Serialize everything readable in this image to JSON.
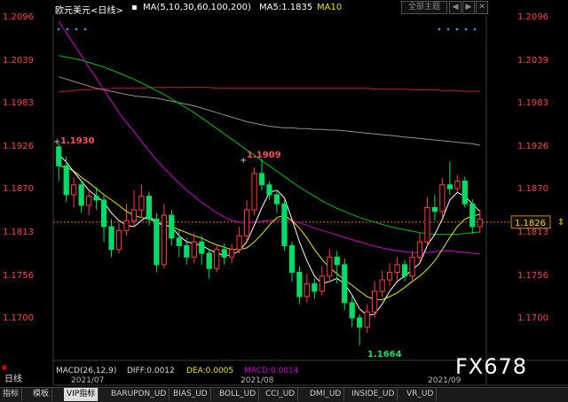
{
  "header": {
    "symbol": "欧元美元<日线>",
    "ma_label": "MA(5,10,30,60,100,200)",
    "ma5_label": "MA5:1.1835",
    "ma10_label": "MA10",
    "theme_button": "全部主题",
    "arrow_left": "◀",
    "arrow_right": "▶",
    "close": "✕"
  },
  "y_axis": {
    "ticks": [
      "1.2096",
      "1.2039",
      "1.1983",
      "1.1926",
      "1.1870",
      "1.1813",
      "1.1756",
      "1.1700"
    ],
    "current_price": "1.1826",
    "current_marker": "⇕"
  },
  "annotations": {
    "left_high": "1.1930",
    "mid_high": "1.1909",
    "low": "1.1664"
  },
  "x_axis": {
    "labels": [
      "2021/07",
      "2021/08",
      "2021/09"
    ]
  },
  "indicator": {
    "day_label": "日线",
    "macd_label": "MACD(26,12,9)",
    "diff_label": "DIFF:0.0012",
    "dea_label": "DEA:0.0005",
    "macd_value": "MACD:0.0014"
  },
  "watermark": "FX678",
  "tabs": [
    "指标",
    "模板",
    "VIP指标",
    "BARUPDN_UD",
    "BIAS_UD",
    "BOLL_UD",
    "CCI_UD",
    "DMI_UD",
    "INSIDE_UD",
    "VR_UD"
  ],
  "colors": {
    "up": "#ff3c3c",
    "down": "#00e0e0",
    "axis_text": "#ff4040",
    "ma5": "#ffffff",
    "ma10": "#e8e800",
    "ma30": "#d000d0",
    "ma60": "#00c000",
    "ma100": "#909090",
    "ma200": "#c02020"
  },
  "chart_data": {
    "type": "candlestick",
    "title": "欧元美元<日线>",
    "x_labels": [
      "2021/07",
      "2021/08",
      "2021/09"
    ],
    "ylim": [
      1.1664,
      1.2096
    ],
    "y_ticks": [
      1.2096,
      1.2039,
      1.1983,
      1.1926,
      1.187,
      1.1813,
      1.1756,
      1.17
    ],
    "current_price": 1.1826,
    "candles": [
      [
        1.1925,
        1.19,
        1.193,
        1.188
      ],
      [
        1.19,
        1.1862,
        1.1912,
        1.1852
      ],
      [
        1.1862,
        1.1875,
        1.1885,
        1.1845
      ],
      [
        1.1875,
        1.1848,
        1.1882,
        1.1838
      ],
      [
        1.1848,
        1.186,
        1.1868,
        1.1835
      ],
      [
        1.186,
        1.1855,
        1.1872,
        1.1842
      ],
      [
        1.1855,
        1.182,
        1.1862,
        1.18
      ],
      [
        1.182,
        1.179,
        1.183,
        1.178
      ],
      [
        1.179,
        1.1815,
        1.1825,
        1.1785
      ],
      [
        1.1815,
        1.1828,
        1.185,
        1.1808
      ],
      [
        1.1828,
        1.1842,
        1.1868,
        1.182
      ],
      [
        1.1842,
        1.186,
        1.1875,
        1.1832
      ],
      [
        1.186,
        1.183,
        1.1866,
        1.1822
      ],
      [
        1.183,
        1.177,
        1.1838,
        1.176
      ],
      [
        1.177,
        1.1835,
        1.185,
        1.1765
      ],
      [
        1.1835,
        1.1805,
        1.1842,
        1.1795
      ],
      [
        1.1805,
        1.1795,
        1.1815,
        1.178
      ],
      [
        1.1795,
        1.178,
        1.1805,
        1.177
      ],
      [
        1.178,
        1.18,
        1.1812,
        1.1772
      ],
      [
        1.18,
        1.1785,
        1.1808,
        1.177
      ],
      [
        1.1785,
        1.1765,
        1.179,
        1.1752
      ],
      [
        1.1765,
        1.179,
        1.1795,
        1.176
      ],
      [
        1.179,
        1.178,
        1.1798,
        1.177
      ],
      [
        1.178,
        1.179,
        1.1797,
        1.1772
      ],
      [
        1.179,
        1.1808,
        1.182,
        1.1785
      ],
      [
        1.1808,
        1.1842,
        1.1855,
        1.18
      ],
      [
        1.1842,
        1.189,
        1.1898,
        1.1835
      ],
      [
        1.189,
        1.1875,
        1.1909,
        1.1868
      ],
      [
        1.1875,
        1.1862,
        1.188,
        1.1855
      ],
      [
        1.1862,
        1.185,
        1.1868,
        1.1838
      ],
      [
        1.185,
        1.1795,
        1.1855,
        1.1788
      ],
      [
        1.1795,
        1.176,
        1.18,
        1.1748
      ],
      [
        1.176,
        1.1728,
        1.1768,
        1.1718
      ],
      [
        1.1728,
        1.1745,
        1.1758,
        1.172
      ],
      [
        1.1745,
        1.1735,
        1.1752,
        1.1725
      ],
      [
        1.1735,
        1.1755,
        1.1768,
        1.173
      ],
      [
        1.1755,
        1.178,
        1.179,
        1.175
      ],
      [
        1.178,
        1.177,
        1.1788,
        1.1745
      ],
      [
        1.177,
        1.172,
        1.1778,
        1.171
      ],
      [
        1.172,
        1.17,
        1.1728,
        1.1688
      ],
      [
        1.17,
        1.1688,
        1.1705,
        1.1664
      ],
      [
        1.1688,
        1.1708,
        1.1718,
        1.168
      ],
      [
        1.1708,
        1.1735,
        1.1748,
        1.17
      ],
      [
        1.1735,
        1.175,
        1.1762,
        1.1728
      ],
      [
        1.175,
        1.176,
        1.1772,
        1.1742
      ],
      [
        1.176,
        1.177,
        1.178,
        1.175
      ],
      [
        1.177,
        1.1755,
        1.1776,
        1.1748
      ],
      [
        1.1755,
        1.178,
        1.1788,
        1.175
      ],
      [
        1.178,
        1.18,
        1.1812,
        1.1775
      ],
      [
        1.18,
        1.1845,
        1.1858,
        1.1795
      ],
      [
        1.1845,
        1.184,
        1.1862,
        1.1828
      ],
      [
        1.184,
        1.1875,
        1.1884,
        1.1833
      ],
      [
        1.1875,
        1.187,
        1.1905,
        1.1862
      ],
      [
        1.187,
        1.188,
        1.1888,
        1.1866
      ],
      [
        1.188,
        1.185,
        1.1886,
        1.1845
      ],
      [
        1.185,
        1.182,
        1.1856,
        1.181
      ],
      [
        1.182,
        1.183,
        1.1842,
        1.1812
      ]
    ],
    "ma5": [
      1.1915,
      1.1905,
      1.1892,
      1.188,
      1.1868,
      1.186,
      1.1852,
      1.1838,
      1.1828,
      1.1822,
      1.182,
      1.1828,
      1.1835,
      1.1825,
      1.1822,
      1.182,
      1.1808,
      1.18,
      1.1798,
      1.1795,
      1.179,
      1.1785,
      1.1782,
      1.1783,
      1.1788,
      1.18,
      1.1822,
      1.1845,
      1.1865,
      1.1868,
      1.1858,
      1.183,
      1.18,
      1.1775,
      1.1755,
      1.1745,
      1.1748,
      1.1752,
      1.1745,
      1.173,
      1.1712,
      1.1703,
      1.1705,
      1.1718,
      1.1735,
      1.1748,
      1.1755,
      1.1763,
      1.1772,
      1.1795,
      1.181,
      1.183,
      1.1855,
      1.1865,
      1.186,
      1.185,
      1.184
    ],
    "ma10": [
      1.19,
      1.1898,
      1.1893,
      1.1885,
      1.1878,
      1.187,
      1.1862,
      1.1855,
      1.1848,
      1.184,
      1.1835,
      1.1832,
      1.183,
      1.1826,
      1.1822,
      1.182,
      1.1816,
      1.1812,
      1.1808,
      1.1805,
      1.18,
      1.1796,
      1.1793,
      1.179,
      1.179,
      1.1792,
      1.18,
      1.181,
      1.1822,
      1.1832,
      1.1835,
      1.1828,
      1.1818,
      1.1805,
      1.179,
      1.1777,
      1.1766,
      1.1758,
      1.175,
      1.1743,
      1.1735,
      1.1728,
      1.1724,
      1.1724,
      1.1728,
      1.1733,
      1.174,
      1.1748,
      1.1755,
      1.1764,
      1.1775,
      1.179,
      1.1806,
      1.182,
      1.183,
      1.1834,
      1.1836
    ],
    "ma30": [
      1.209,
      1.2075,
      1.206,
      1.2045,
      1.203,
      1.2015,
      1.2,
      1.1985,
      1.197,
      1.1957,
      1.1945,
      1.1932,
      1.192,
      1.1908,
      1.1897,
      1.1887,
      1.1877,
      1.1868,
      1.186,
      1.1852,
      1.1845,
      1.1838,
      1.1833,
      1.1828,
      1.1826,
      1.1825,
      1.1826,
      1.1827,
      1.1828,
      1.1829,
      1.183,
      1.1828,
      1.1825,
      1.1822,
      1.1818,
      1.1815,
      1.1812,
      1.1809,
      1.1806,
      1.1803,
      1.18,
      1.1797,
      1.1794,
      1.1792,
      1.179,
      1.1788,
      1.1787,
      1.1786,
      1.1786,
      1.1786,
      1.1787,
      1.1788,
      1.1788,
      1.1787,
      1.1786,
      1.1785,
      1.1784
    ],
    "ma60": [
      1.2045,
      1.2043,
      1.2041,
      1.2039,
      1.2036,
      1.2033,
      1.203,
      1.2026,
      1.2022,
      1.2018,
      1.2014,
      1.2009,
      1.2004,
      1.1999,
      1.1994,
      1.1988,
      1.1982,
      1.1976,
      1.197,
      1.1963,
      1.1956,
      1.1949,
      1.1942,
      1.1935,
      1.1928,
      1.1921,
      1.1914,
      1.1907,
      1.19,
      1.1893,
      1.1886,
      1.1879,
      1.1872,
      1.1866,
      1.186,
      1.1854,
      1.1849,
      1.1844,
      1.184,
      1.1836,
      1.1832,
      1.1829,
      1.1826,
      1.1823,
      1.182,
      1.1818,
      1.1816,
      1.1814,
      1.1812,
      1.1811,
      1.181,
      1.181,
      1.181,
      1.181,
      1.1811,
      1.1812,
      1.1813
    ],
    "ma100": [
      1.2017,
      1.2014,
      1.2011,
      1.2008,
      1.2005,
      1.2002,
      1.2,
      1.1998,
      1.1996,
      1.1994,
      1.1992,
      1.1991,
      1.199,
      1.1989,
      1.1987,
      1.1985,
      1.1983,
      1.1981,
      1.1979,
      1.1976,
      1.1973,
      1.197,
      1.1967,
      1.1964,
      1.1961,
      1.1958,
      1.1956,
      1.1954,
      1.1952,
      1.1951,
      1.195,
      1.195,
      1.1949,
      1.1949,
      1.1948,
      1.1948,
      1.1947,
      1.1947,
      1.1946,
      1.1945,
      1.1944,
      1.1943,
      1.1942,
      1.1941,
      1.194,
      1.1939,
      1.1938,
      1.1937,
      1.1936,
      1.1935,
      1.1934,
      1.1933,
      1.1932,
      1.1931,
      1.193,
      1.1929,
      1.1927
    ],
    "ma200": [
      1.1997,
      1.1998,
      1.1999,
      1.2,
      1.2,
      1.2001,
      1.2001,
      1.2002,
      1.2002,
      1.2002,
      1.2002,
      1.2002,
      1.2003,
      1.2003,
      1.2003,
      1.2003,
      1.2003,
      1.2003,
      1.2003,
      1.2003,
      1.2003,
      1.2002,
      1.2002,
      1.2002,
      1.2002,
      1.2002,
      1.2002,
      1.2002,
      1.2002,
      1.2002,
      1.2002,
      1.2002,
      1.2002,
      1.2002,
      1.2002,
      1.2002,
      1.2002,
      1.2002,
      1.2002,
      1.2002,
      1.2002,
      1.2002,
      1.2001,
      1.2001,
      1.2001,
      1.2001,
      1.2001,
      1.2,
      1.2,
      1.2,
      1.2,
      1.1999,
      1.1999,
      1.1999,
      1.1998,
      1.1998,
      1.1998
    ]
  }
}
